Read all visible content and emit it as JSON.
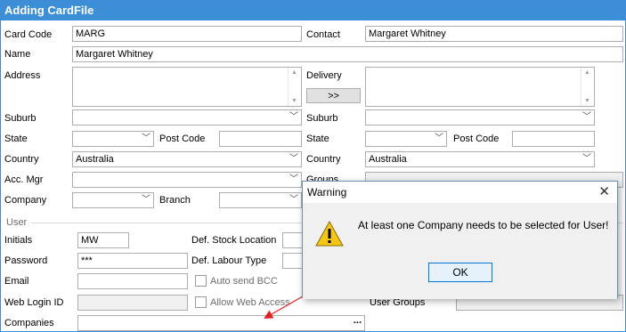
{
  "window": {
    "title": "Adding CardFile"
  },
  "top": {
    "card_code_label": "Card Code",
    "card_code_value": "MARG",
    "contact_label": "Contact",
    "contact_value": "Margaret Whitney",
    "name_label": "Name",
    "name_value": "Margaret Whitney",
    "address_label": "Address",
    "delivery_label": "Delivery",
    "copy_button_label": ">>",
    "suburb_label_left": "Suburb",
    "suburb_label_right": "Suburb",
    "state_label_left": "State",
    "postcode_label_left": "Post Code",
    "state_label_right": "State",
    "postcode_label_right": "Post Code",
    "country_label_left": "Country",
    "country_value_left": "Australia",
    "country_label_right": "Country",
    "country_value_right": "Australia",
    "accmgr_label": "Acc. Mgr",
    "groups_label": "Groups",
    "company_label": "Company",
    "branch_label": "Branch"
  },
  "user": {
    "section_label": "User",
    "initials_label": "Initials",
    "initials_value": "MW",
    "password_label": "Password",
    "password_value": "***",
    "email_label": "Email",
    "weblogin_label": "Web Login ID",
    "companies_label": "Companies",
    "companies_button": "...",
    "stock_location_label": "Def. Stock Location",
    "labour_type_label": "Def. Labour Type",
    "auto_bcc_label": "Auto send BCC",
    "allow_web_label": "Allow Web Access",
    "user_groups_label": "User Groups"
  },
  "dialog": {
    "title": "Warning",
    "close": "✕",
    "message": "At least one Company needs to be selected for User!",
    "ok_label": "OK"
  },
  "colors": {
    "titlebar": "#3c8fd6",
    "arrow": "#e02020",
    "warning_icon": "#f5c518"
  }
}
